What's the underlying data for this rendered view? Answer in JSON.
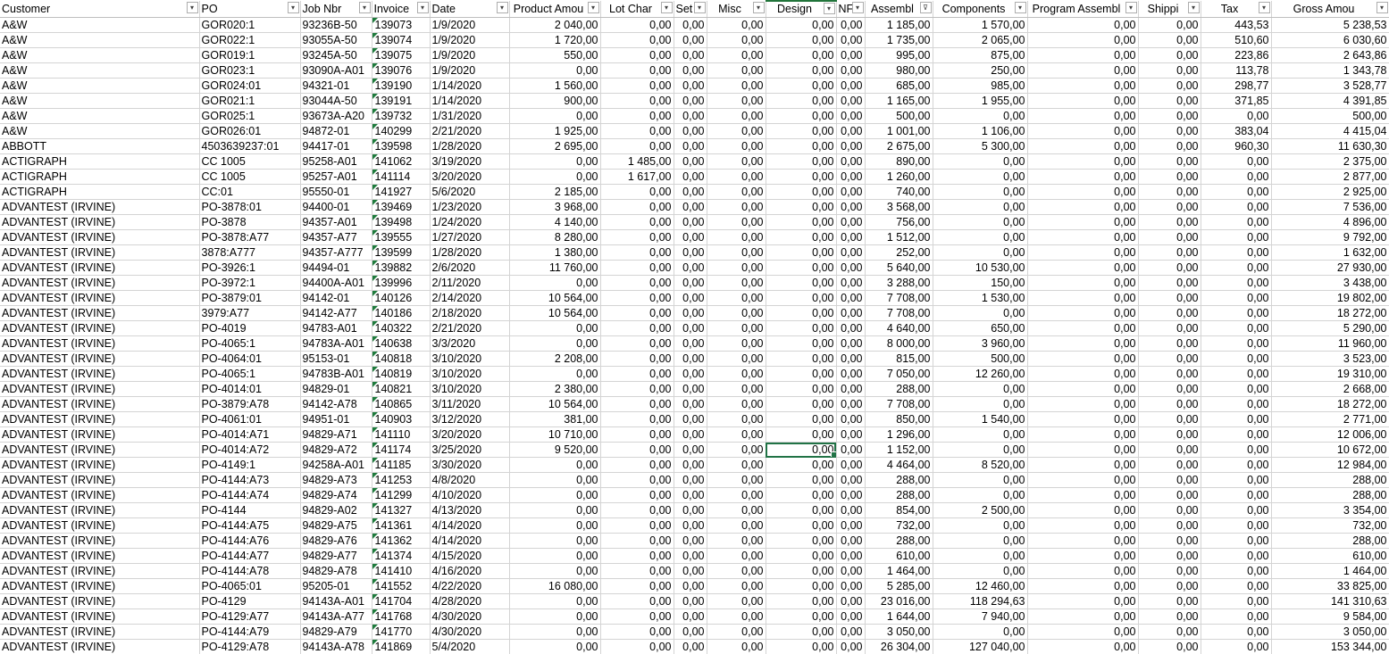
{
  "columns": [
    {
      "label": "Customer",
      "filter": "▾"
    },
    {
      "label": "PO",
      "filter": "▾"
    },
    {
      "label": "Job Nbr",
      "filter": "▾"
    },
    {
      "label": "Invoice",
      "filter": "▾"
    },
    {
      "label": "Date",
      "filter": "▾"
    },
    {
      "label": "Product Amou",
      "filter": "▾"
    },
    {
      "label": "Lot Char",
      "filter": "▾"
    },
    {
      "label": "Set",
      "filter": "▾"
    },
    {
      "label": "Misc",
      "filter": "▾"
    },
    {
      "label": "Design",
      "filter": "▾"
    },
    {
      "label": "NF",
      "filter": "▾"
    },
    {
      "label": "Assembl",
      "filter": "⊽"
    },
    {
      "label": "Components",
      "filter": "▾"
    },
    {
      "label": "Program Assembl",
      "filter": "▾"
    },
    {
      "label": "Shippi",
      "filter": "▾"
    },
    {
      "label": "Tax",
      "filter": "▾"
    },
    {
      "label": "Gross Amou",
      "filter": "▾"
    }
  ],
  "rows": [
    [
      "A&W",
      "GOR020:1",
      "93236B-50",
      "139073",
      "1/9/2020",
      "2 040,00",
      "0,00",
      "0,00",
      "0,00",
      "0,00",
      "0,00",
      "1 185,00",
      "1 570,00",
      "0,00",
      "0,00",
      "443,53",
      "5 238,53"
    ],
    [
      "A&W",
      "GOR022:1",
      "93055A-50",
      "139074",
      "1/9/2020",
      "1 720,00",
      "0,00",
      "0,00",
      "0,00",
      "0,00",
      "0,00",
      "1 735,00",
      "2 065,00",
      "0,00",
      "0,00",
      "510,60",
      "6 030,60"
    ],
    [
      "A&W",
      "GOR019:1",
      "93245A-50",
      "139075",
      "1/9/2020",
      "550,00",
      "0,00",
      "0,00",
      "0,00",
      "0,00",
      "0,00",
      "995,00",
      "875,00",
      "0,00",
      "0,00",
      "223,86",
      "2 643,86"
    ],
    [
      "A&W",
      "GOR023:1",
      "93090A-A01",
      "139076",
      "1/9/2020",
      "0,00",
      "0,00",
      "0,00",
      "0,00",
      "0,00",
      "0,00",
      "980,00",
      "250,00",
      "0,00",
      "0,00",
      "113,78",
      "1 343,78"
    ],
    [
      "A&W",
      "GOR024:01",
      "94321-01",
      "139190",
      "1/14/2020",
      "1 560,00",
      "0,00",
      "0,00",
      "0,00",
      "0,00",
      "0,00",
      "685,00",
      "985,00",
      "0,00",
      "0,00",
      "298,77",
      "3 528,77"
    ],
    [
      "A&W",
      "GOR021:1",
      "93044A-50",
      "139191",
      "1/14/2020",
      "900,00",
      "0,00",
      "0,00",
      "0,00",
      "0,00",
      "0,00",
      "1 165,00",
      "1 955,00",
      "0,00",
      "0,00",
      "371,85",
      "4 391,85"
    ],
    [
      "A&W",
      "GOR025:1",
      "93673A-A20",
      "139732",
      "1/31/2020",
      "0,00",
      "0,00",
      "0,00",
      "0,00",
      "0,00",
      "0,00",
      "500,00",
      "0,00",
      "0,00",
      "0,00",
      "0,00",
      "500,00"
    ],
    [
      "A&W",
      "GOR026:01",
      "94872-01",
      "140299",
      "2/21/2020",
      "1 925,00",
      "0,00",
      "0,00",
      "0,00",
      "0,00",
      "0,00",
      "1 001,00",
      "1 106,00",
      "0,00",
      "0,00",
      "383,04",
      "4 415,04"
    ],
    [
      "ABBOTT",
      "4503639237:01",
      "94417-01",
      "139598",
      "1/28/2020",
      "2 695,00",
      "0,00",
      "0,00",
      "0,00",
      "0,00",
      "0,00",
      "2 675,00",
      "5 300,00",
      "0,00",
      "0,00",
      "960,30",
      "11 630,30"
    ],
    [
      "ACTIGRAPH",
      "CC 1005",
      "95258-A01",
      "141062",
      "3/19/2020",
      "0,00",
      "1 485,00",
      "0,00",
      "0,00",
      "0,00",
      "0,00",
      "890,00",
      "0,00",
      "0,00",
      "0,00",
      "0,00",
      "2 375,00"
    ],
    [
      "ACTIGRAPH",
      "CC 1005",
      "95257-A01",
      "141114",
      "3/20/2020",
      "0,00",
      "1 617,00",
      "0,00",
      "0,00",
      "0,00",
      "0,00",
      "1 260,00",
      "0,00",
      "0,00",
      "0,00",
      "0,00",
      "2 877,00"
    ],
    [
      "ACTIGRAPH",
      "CC:01",
      "95550-01",
      "141927",
      "5/6/2020",
      "2 185,00",
      "0,00",
      "0,00",
      "0,00",
      "0,00",
      "0,00",
      "740,00",
      "0,00",
      "0,00",
      "0,00",
      "0,00",
      "2 925,00"
    ],
    [
      "ADVANTEST (IRVINE)",
      "PO-3878:01",
      "94400-01",
      "139469",
      "1/23/2020",
      "3 968,00",
      "0,00",
      "0,00",
      "0,00",
      "0,00",
      "0,00",
      "3 568,00",
      "0,00",
      "0,00",
      "0,00",
      "0,00",
      "7 536,00"
    ],
    [
      "ADVANTEST (IRVINE)",
      "PO-3878",
      "94357-A01",
      "139498",
      "1/24/2020",
      "4 140,00",
      "0,00",
      "0,00",
      "0,00",
      "0,00",
      "0,00",
      "756,00",
      "0,00",
      "0,00",
      "0,00",
      "0,00",
      "4 896,00"
    ],
    [
      "ADVANTEST (IRVINE)",
      "PO-3878:A77",
      "94357-A77",
      "139555",
      "1/27/2020",
      "8 280,00",
      "0,00",
      "0,00",
      "0,00",
      "0,00",
      "0,00",
      "1 512,00",
      "0,00",
      "0,00",
      "0,00",
      "0,00",
      "9 792,00"
    ],
    [
      "ADVANTEST (IRVINE)",
      "3878:A777",
      "94357-A777",
      "139599",
      "1/28/2020",
      "1 380,00",
      "0,00",
      "0,00",
      "0,00",
      "0,00",
      "0,00",
      "252,00",
      "0,00",
      "0,00",
      "0,00",
      "0,00",
      "1 632,00"
    ],
    [
      "ADVANTEST (IRVINE)",
      "PO-3926:1",
      "94494-01",
      "139882",
      "2/6/2020",
      "11 760,00",
      "0,00",
      "0,00",
      "0,00",
      "0,00",
      "0,00",
      "5 640,00",
      "10 530,00",
      "0,00",
      "0,00",
      "0,00",
      "27 930,00"
    ],
    [
      "ADVANTEST (IRVINE)",
      "PO-3972:1",
      "94400A-A01",
      "139996",
      "2/11/2020",
      "0,00",
      "0,00",
      "0,00",
      "0,00",
      "0,00",
      "0,00",
      "3 288,00",
      "150,00",
      "0,00",
      "0,00",
      "0,00",
      "3 438,00"
    ],
    [
      "ADVANTEST (IRVINE)",
      "PO-3879:01",
      "94142-01",
      "140126",
      "2/14/2020",
      "10 564,00",
      "0,00",
      "0,00",
      "0,00",
      "0,00",
      "0,00",
      "7 708,00",
      "1 530,00",
      "0,00",
      "0,00",
      "0,00",
      "19 802,00"
    ],
    [
      "ADVANTEST (IRVINE)",
      "3979:A77",
      "94142-A77",
      "140186",
      "2/18/2020",
      "10 564,00",
      "0,00",
      "0,00",
      "0,00",
      "0,00",
      "0,00",
      "7 708,00",
      "0,00",
      "0,00",
      "0,00",
      "0,00",
      "18 272,00"
    ],
    [
      "ADVANTEST (IRVINE)",
      "PO-4019",
      "94783-A01",
      "140322",
      "2/21/2020",
      "0,00",
      "0,00",
      "0,00",
      "0,00",
      "0,00",
      "0,00",
      "4 640,00",
      "650,00",
      "0,00",
      "0,00",
      "0,00",
      "5 290,00"
    ],
    [
      "ADVANTEST (IRVINE)",
      "PO-4065:1",
      "94783A-A01",
      "140638",
      "3/3/2020",
      "0,00",
      "0,00",
      "0,00",
      "0,00",
      "0,00",
      "0,00",
      "8 000,00",
      "3 960,00",
      "0,00",
      "0,00",
      "0,00",
      "11 960,00"
    ],
    [
      "ADVANTEST (IRVINE)",
      "PO-4064:01",
      "95153-01",
      "140818",
      "3/10/2020",
      "2 208,00",
      "0,00",
      "0,00",
      "0,00",
      "0,00",
      "0,00",
      "815,00",
      "500,00",
      "0,00",
      "0,00",
      "0,00",
      "3 523,00"
    ],
    [
      "ADVANTEST (IRVINE)",
      "PO-4065:1",
      "94783B-A01",
      "140819",
      "3/10/2020",
      "0,00",
      "0,00",
      "0,00",
      "0,00",
      "0,00",
      "0,00",
      "7 050,00",
      "12 260,00",
      "0,00",
      "0,00",
      "0,00",
      "19 310,00"
    ],
    [
      "ADVANTEST (IRVINE)",
      "PO-4014:01",
      "94829-01",
      "140821",
      "3/10/2020",
      "2 380,00",
      "0,00",
      "0,00",
      "0,00",
      "0,00",
      "0,00",
      "288,00",
      "0,00",
      "0,00",
      "0,00",
      "0,00",
      "2 668,00"
    ],
    [
      "ADVANTEST (IRVINE)",
      "PO-3879:A78",
      "94142-A78",
      "140865",
      "3/11/2020",
      "10 564,00",
      "0,00",
      "0,00",
      "0,00",
      "0,00",
      "0,00",
      "7 708,00",
      "0,00",
      "0,00",
      "0,00",
      "0,00",
      "18 272,00"
    ],
    [
      "ADVANTEST (IRVINE)",
      "PO-4061:01",
      "94951-01",
      "140903",
      "3/12/2020",
      "381,00",
      "0,00",
      "0,00",
      "0,00",
      "0,00",
      "0,00",
      "850,00",
      "1 540,00",
      "0,00",
      "0,00",
      "0,00",
      "2 771,00"
    ],
    [
      "ADVANTEST (IRVINE)",
      "PO-4014:A71",
      "94829-A71",
      "141110",
      "3/20/2020",
      "10 710,00",
      "0,00",
      "0,00",
      "0,00",
      "0,00",
      "0,00",
      "1 296,00",
      "0,00",
      "0,00",
      "0,00",
      "0,00",
      "12 006,00"
    ],
    [
      "ADVANTEST (IRVINE)",
      "PO-4014:A72",
      "94829-A72",
      "141174",
      "3/25/2020",
      "9 520,00",
      "0,00",
      "0,00",
      "0,00",
      "0,00",
      "0,00",
      "1 152,00",
      "0,00",
      "0,00",
      "0,00",
      "0,00",
      "10 672,00"
    ],
    [
      "ADVANTEST (IRVINE)",
      "PO-4149:1",
      "94258A-A01",
      "141185",
      "3/30/2020",
      "0,00",
      "0,00",
      "0,00",
      "0,00",
      "0,00",
      "0,00",
      "4 464,00",
      "8 520,00",
      "0,00",
      "0,00",
      "0,00",
      "12 984,00"
    ],
    [
      "ADVANTEST (IRVINE)",
      "PO-4144:A73",
      "94829-A73",
      "141253",
      "4/8/2020",
      "0,00",
      "0,00",
      "0,00",
      "0,00",
      "0,00",
      "0,00",
      "288,00",
      "0,00",
      "0,00",
      "0,00",
      "0,00",
      "288,00"
    ],
    [
      "ADVANTEST (IRVINE)",
      "PO-4144:A74",
      "94829-A74",
      "141299",
      "4/10/2020",
      "0,00",
      "0,00",
      "0,00",
      "0,00",
      "0,00",
      "0,00",
      "288,00",
      "0,00",
      "0,00",
      "0,00",
      "0,00",
      "288,00"
    ],
    [
      "ADVANTEST (IRVINE)",
      "PO-4144",
      "94829-A02",
      "141327",
      "4/13/2020",
      "0,00",
      "0,00",
      "0,00",
      "0,00",
      "0,00",
      "0,00",
      "854,00",
      "2 500,00",
      "0,00",
      "0,00",
      "0,00",
      "3 354,00"
    ],
    [
      "ADVANTEST (IRVINE)",
      "PO-4144:A75",
      "94829-A75",
      "141361",
      "4/14/2020",
      "0,00",
      "0,00",
      "0,00",
      "0,00",
      "0,00",
      "0,00",
      "732,00",
      "0,00",
      "0,00",
      "0,00",
      "0,00",
      "732,00"
    ],
    [
      "ADVANTEST (IRVINE)",
      "PO-4144:A76",
      "94829-A76",
      "141362",
      "4/14/2020",
      "0,00",
      "0,00",
      "0,00",
      "0,00",
      "0,00",
      "0,00",
      "288,00",
      "0,00",
      "0,00",
      "0,00",
      "0,00",
      "288,00"
    ],
    [
      "ADVANTEST (IRVINE)",
      "PO-4144:A77",
      "94829-A77",
      "141374",
      "4/15/2020",
      "0,00",
      "0,00",
      "0,00",
      "0,00",
      "0,00",
      "0,00",
      "610,00",
      "0,00",
      "0,00",
      "0,00",
      "0,00",
      "610,00"
    ],
    [
      "ADVANTEST (IRVINE)",
      "PO-4144:A78",
      "94829-A78",
      "141410",
      "4/16/2020",
      "0,00",
      "0,00",
      "0,00",
      "0,00",
      "0,00",
      "0,00",
      "1 464,00",
      "0,00",
      "0,00",
      "0,00",
      "0,00",
      "1 464,00"
    ],
    [
      "ADVANTEST (IRVINE)",
      "PO-4065:01",
      "95205-01",
      "141552",
      "4/22/2020",
      "16 080,00",
      "0,00",
      "0,00",
      "0,00",
      "0,00",
      "0,00",
      "5 285,00",
      "12 460,00",
      "0,00",
      "0,00",
      "0,00",
      "33 825,00"
    ],
    [
      "ADVANTEST (IRVINE)",
      "PO-4129",
      "94143A-A01",
      "141704",
      "4/28/2020",
      "0,00",
      "0,00",
      "0,00",
      "0,00",
      "0,00",
      "0,00",
      "23 016,00",
      "118 294,63",
      "0,00",
      "0,00",
      "0,00",
      "141 310,63"
    ],
    [
      "ADVANTEST (IRVINE)",
      "PO-4129:A77",
      "94143A-A77",
      "141768",
      "4/30/2020",
      "0,00",
      "0,00",
      "0,00",
      "0,00",
      "0,00",
      "0,00",
      "1 644,00",
      "7 940,00",
      "0,00",
      "0,00",
      "0,00",
      "9 584,00"
    ],
    [
      "ADVANTEST (IRVINE)",
      "PO-4144:A79",
      "94829-A79",
      "141770",
      "4/30/2020",
      "0,00",
      "0,00",
      "0,00",
      "0,00",
      "0,00",
      "0,00",
      "3 050,00",
      "0,00",
      "0,00",
      "0,00",
      "0,00",
      "3 050,00"
    ],
    [
      "ADVANTEST (IRVINE)",
      "PO-4129:A78",
      "94143A-A78",
      "141869",
      "5/4/2020",
      "0,00",
      "0,00",
      "0,00",
      "0,00",
      "0,00",
      "0,00",
      "26 304,00",
      "127 040,00",
      "0,00",
      "0,00",
      "0,00",
      "153 344,00"
    ]
  ],
  "selected_cell": {
    "row": 28,
    "col": 9
  },
  "colors": {
    "grid": "#d4d4d4",
    "selection": "#217346",
    "invoice_marker": "#1e7b3c"
  },
  "icons": {
    "filter": "filter-dropdown-icon",
    "filter_active": "filter-active-icon",
    "invoice_marker": "number-stored-as-text-icon"
  }
}
